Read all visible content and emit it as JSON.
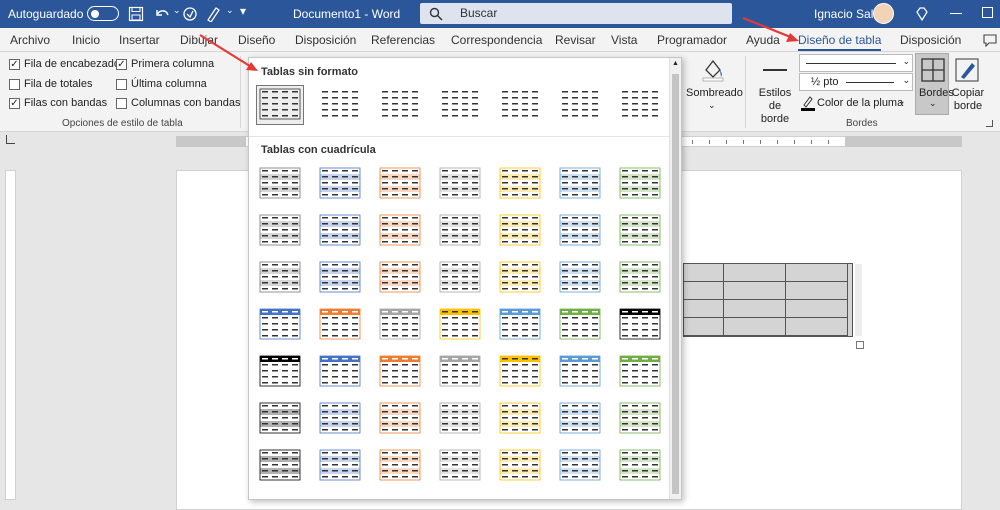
{
  "titlebar": {
    "autosave_label": "Autoguardado",
    "doc_title": "Documento1  -  Word",
    "search_placeholder": "Buscar",
    "user_name": "Ignacio Sala"
  },
  "tabs": [
    "Archivo",
    "Inicio",
    "Insertar",
    "Dibujar",
    "Diseño",
    "Disposición",
    "Referencias",
    "Correspondencia",
    "Revisar",
    "Vista",
    "Programador",
    "Ayuda",
    "Diseño de tabla",
    "Disposición"
  ],
  "active_tab": "Diseño de tabla",
  "style_options": {
    "items": [
      {
        "label": "Fila de encabezado",
        "checked": true
      },
      {
        "label": "Primera columna",
        "checked": true
      },
      {
        "label": "Fila de totales",
        "checked": false
      },
      {
        "label": "Última columna",
        "checked": false
      },
      {
        "label": "Filas con bandas",
        "checked": true
      },
      {
        "label": "Columnas con bandas",
        "checked": false
      }
    ],
    "group_label": "Opciones de estilo de tabla"
  },
  "borders_group": {
    "shading_label": "Sombreado",
    "border_styles_label": "Estilos de borde",
    "pen_weight": "½ pto",
    "pen_color_label": "Color de la pluma",
    "borders_label": "Bordes",
    "copy_border_label": "Copiar borde",
    "group_label": "Bordes"
  },
  "gallery": {
    "section1": "Tablas sin formato",
    "section2": "Tablas con cuadrícula",
    "row_colors": [
      [
        "#777777",
        "#4472c4",
        "#ed7d31",
        "#a5a5a5",
        "#ffc000",
        "#5b9bd5",
        "#70ad47"
      ],
      [
        "#777777",
        "#4472c4",
        "#ed7d31",
        "#a5a5a5",
        "#ffc000",
        "#5b9bd5",
        "#70ad47"
      ],
      [
        "#777777",
        "#4472c4",
        "#ed7d31",
        "#a5a5a5",
        "#ffc000",
        "#5b9bd5",
        "#70ad47"
      ],
      [
        "#4472c4",
        "#ed7d31",
        "#a5a5a5",
        "#ffc000",
        "#5b9bd5",
        "#70ad47",
        "#000000"
      ],
      [
        "#000000",
        "#4472c4",
        "#ed7d31",
        "#a5a5a5",
        "#ffc000",
        "#5b9bd5",
        "#70ad47"
      ],
      [
        "#000000",
        "#4472c4",
        "#ed7d31",
        "#a5a5a5",
        "#ffc000",
        "#5b9bd5",
        "#70ad47"
      ],
      [
        "#000000",
        "#4472c4",
        "#ed7d31",
        "#a5a5a5",
        "#ffc000",
        "#5b9bd5",
        "#70ad47"
      ]
    ]
  },
  "colors": {
    "titlebar": "#2b579a",
    "accent": "#2b579a",
    "annotation_arrow": "#e53935"
  }
}
